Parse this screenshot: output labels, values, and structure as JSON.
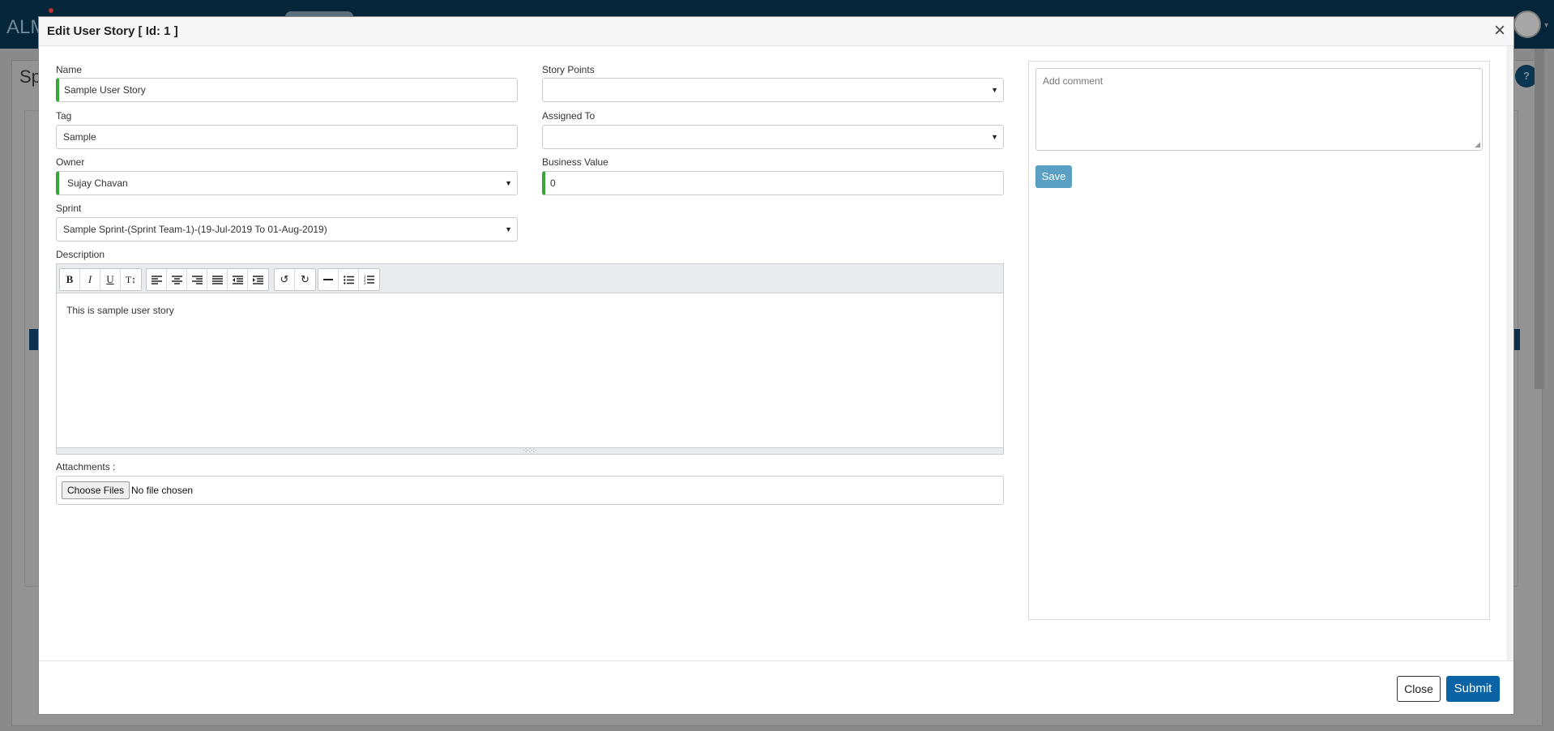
{
  "background": {
    "logo_text": "ALM",
    "page_title": "Sp"
  },
  "modal": {
    "title": "Edit User Story  [ Id: 1 ]",
    "close_icon": "close-icon",
    "form": {
      "name": {
        "label": "Name",
        "value": "Sample User Story"
      },
      "story_points": {
        "label": "Story Points",
        "value": ""
      },
      "tag": {
        "label": "Tag",
        "value": "Sample"
      },
      "assigned_to": {
        "label": "Assigned To",
        "value": ""
      },
      "owner": {
        "label": "Owner",
        "value": "Sujay Chavan"
      },
      "business_value": {
        "label": "Business Value",
        "value": "0"
      },
      "sprint": {
        "label": "Sprint",
        "value": "Sample Sprint-(Sprint Team-1)-(19-Jul-2019 To 01-Aug-2019)"
      },
      "description": {
        "label": "Description",
        "text": "This is sample user story"
      },
      "attachments": {
        "label": "Attachments :",
        "button": "Choose Files",
        "status": "No file chosen"
      }
    },
    "toolbar": [
      "bold-icon",
      "italic-icon",
      "underline-icon",
      "text-size-icon",
      "align-left-icon",
      "align-center-icon",
      "align-right-icon",
      "align-justify-icon",
      "outdent-icon",
      "indent-icon",
      "undo-icon",
      "redo-icon",
      "horizontal-rule-icon",
      "bullet-list-icon",
      "numbered-list-icon"
    ],
    "comments": {
      "placeholder": "Add comment",
      "save_label": "Save"
    },
    "footer": {
      "close_label": "Close",
      "submit_label": "Submit"
    }
  },
  "colors": {
    "required_marker": "#3aa53a",
    "submit": "#0a63a5",
    "save": "#5a9fc4",
    "topbar": "#04253a"
  }
}
